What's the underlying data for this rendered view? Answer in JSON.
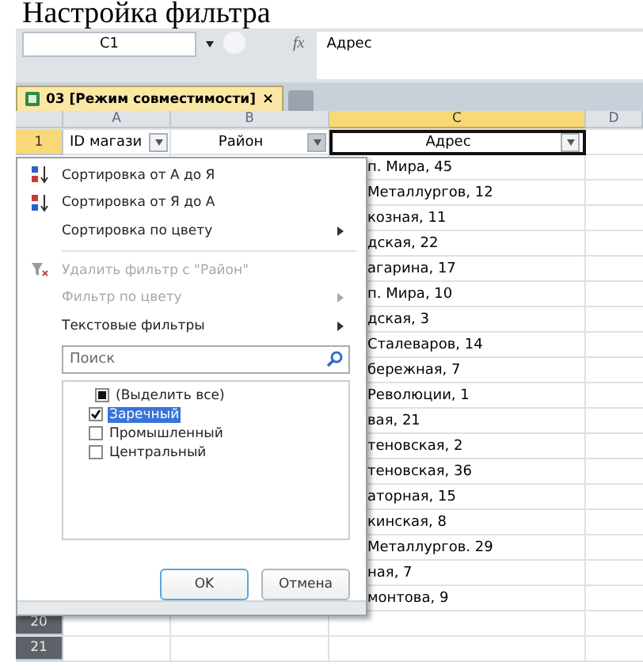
{
  "title": "Настройка фильтра",
  "formula_bar": {
    "name_box": "C1",
    "function_label": "fx",
    "value": "Адрес"
  },
  "tabs": [
    {
      "label": "03  [Режим совместимости]",
      "close": "×",
      "selected": true
    }
  ],
  "columns": [
    {
      "label": "A",
      "selected": false
    },
    {
      "label": "B",
      "selected": false
    },
    {
      "label": "C",
      "selected": true
    },
    {
      "label": "D",
      "selected": false
    }
  ],
  "header_row": {
    "number": "1",
    "selected": true,
    "cells": [
      {
        "text": "ID магази",
        "selected": false,
        "filter_open": false
      },
      {
        "text": "Район",
        "selected": false,
        "filter_open": true
      },
      {
        "text": "Адрес",
        "selected": true,
        "filter_open": false
      }
    ]
  },
  "address_rows": [
    "п. Мира, 45",
    "Металлургов, 12",
    "козная, 11",
    "дская, 22",
    "агарина, 17",
    "п. Мира, 10",
    "дская, 3",
    "Сталеваров, 14",
    "бережная, 7",
    "Революции, 1",
    "вая, 21",
    "теновская, 2",
    "теновская, 36",
    "аторная, 15",
    "кинская, 8",
    "Металлургов. 29",
    "ная, 7",
    "монтова, 9"
  ],
  "bottom_rows": [
    "20",
    "21"
  ],
  "filter_menu": {
    "items": [
      {
        "kind": "item",
        "label": "Сортировка от А до Я",
        "disabled": false,
        "submenu": false
      },
      {
        "kind": "item",
        "label": "Сортировка от Я до А",
        "disabled": false,
        "submenu": false
      },
      {
        "kind": "item",
        "label": "Сортировка по цвету",
        "disabled": false,
        "submenu": true
      },
      {
        "kind": "separator"
      },
      {
        "kind": "item",
        "label": "Удалить фильтр с \"Район\"",
        "disabled": true,
        "submenu": false
      },
      {
        "kind": "item",
        "label": "Фильтр по цвету",
        "disabled": true,
        "submenu": true
      },
      {
        "kind": "item",
        "label": "Текстовые фильтры",
        "disabled": false,
        "submenu": true
      }
    ],
    "search": {
      "placeholder": "Поиск"
    },
    "values": {
      "label": "(Выделить все)",
      "checked": false,
      "partial": true,
      "selected": false,
      "children": [
        {
          "label": "Заречный",
          "checked": true,
          "selected": true
        },
        {
          "label": "Промышленный",
          "checked": false,
          "selected": false
        },
        {
          "label": "Центральный",
          "checked": false,
          "selected": false
        }
      ]
    },
    "buttons": [
      {
        "label": "OK",
        "default": true
      },
      {
        "label": "Отмена",
        "default": false
      }
    ]
  }
}
